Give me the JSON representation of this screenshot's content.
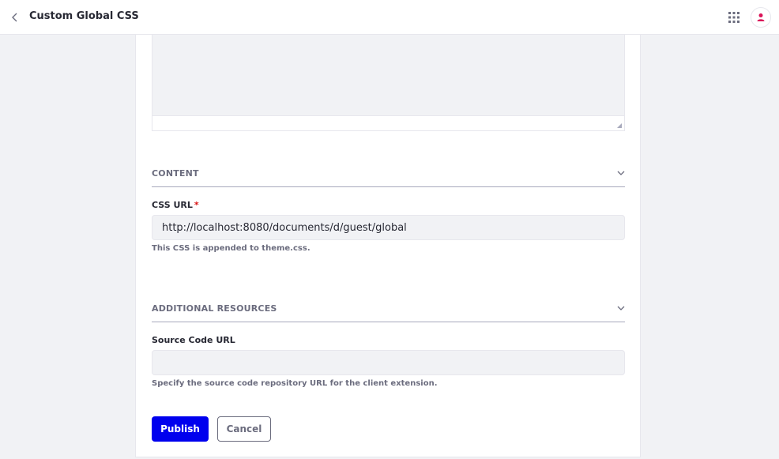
{
  "header": {
    "title": "Custom Global CSS",
    "back_icon": "chevron-left-icon",
    "apps_icon": "apps-grid-icon",
    "user_icon": "user-icon",
    "accent_color": "#da1458"
  },
  "form": {
    "content_section": {
      "title": "CONTENT",
      "css_url": {
        "label": "CSS URL",
        "required_mark": "*",
        "value": "http://localhost:8080/documents/d/guest/global",
        "help": "This CSS is appended to theme.css."
      }
    },
    "additional_resources_section": {
      "title": "ADDITIONAL RESOURCES",
      "source_code_url": {
        "label": "Source Code URL",
        "value": "",
        "help": "Specify the source code repository URL for the client extension."
      }
    },
    "actions": {
      "publish_label": "Publish",
      "cancel_label": "Cancel"
    }
  }
}
